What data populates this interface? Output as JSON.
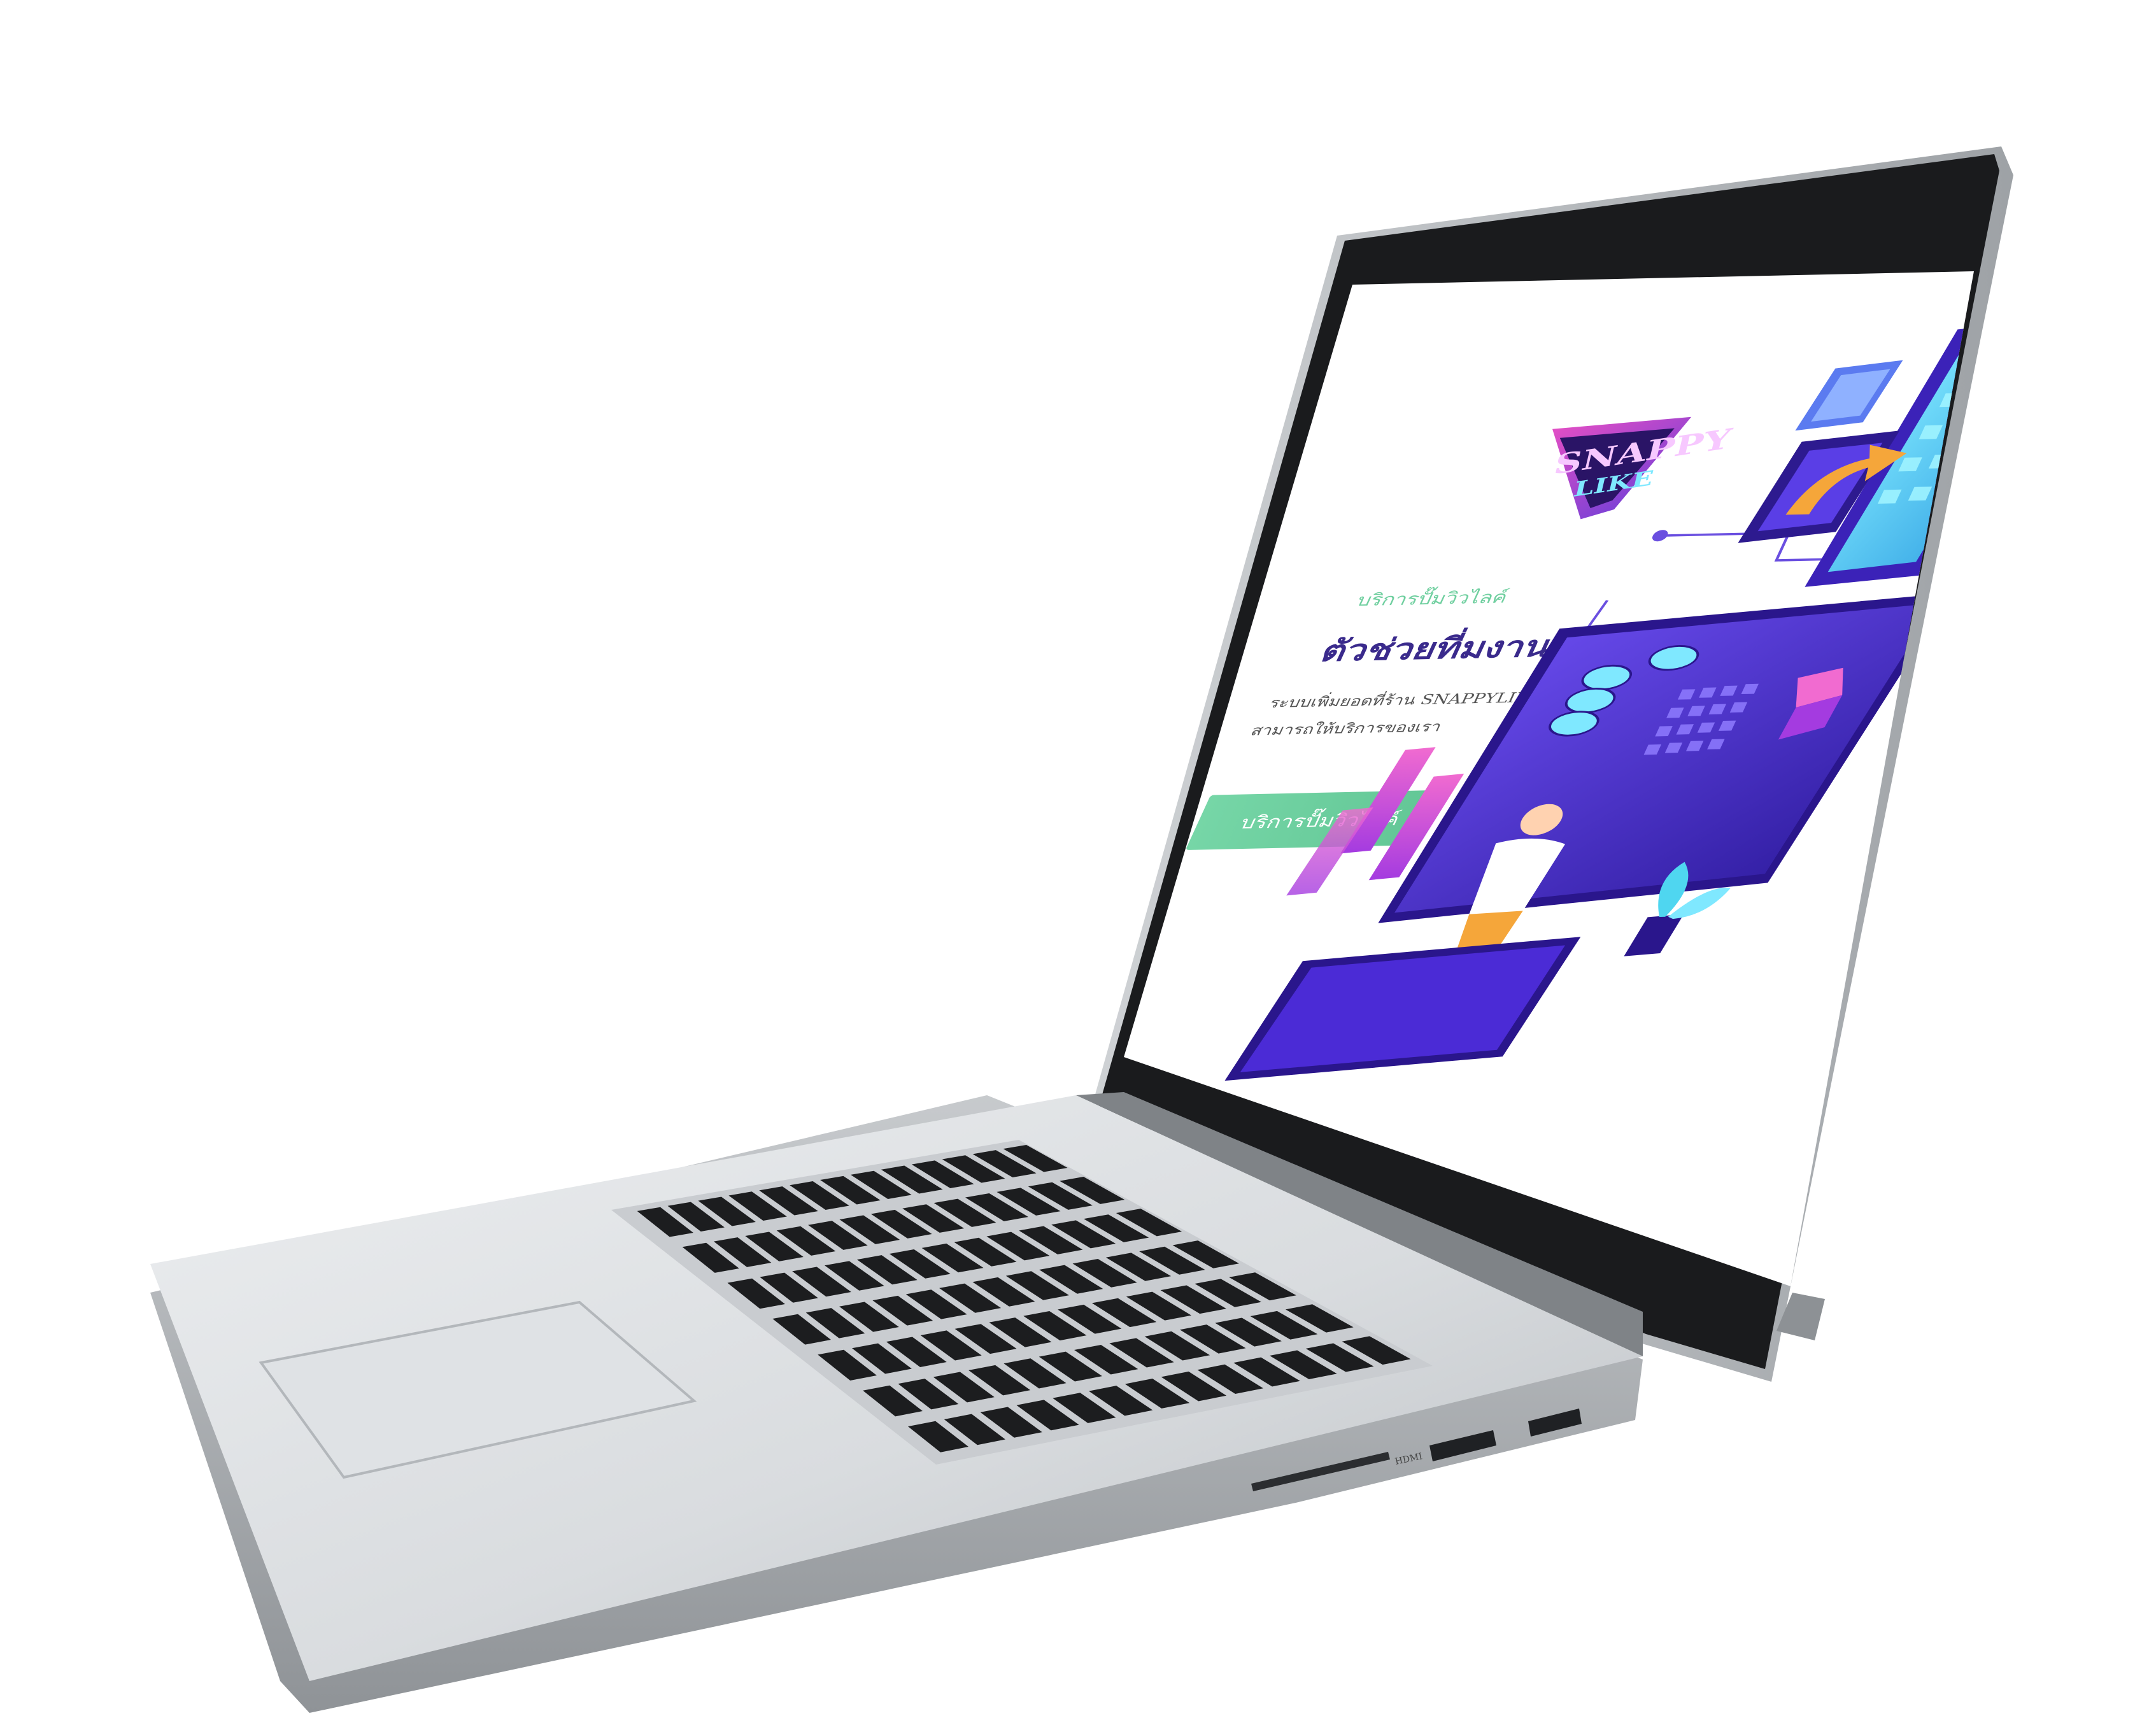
{
  "colors": {
    "accent_green": "#6fcf9f",
    "heading_purple": "#3a2a8c",
    "body_text": "#555555",
    "button_text": "#ffffff",
    "logo_pink": "#e84fc4",
    "logo_violet": "#6a3fd8",
    "illustration_primary": "#4b2bd6",
    "illustration_cyan": "#4fd6f0",
    "illustration_orange": "#f5a63a"
  },
  "website": {
    "logo": {
      "icon": "snappylike-logo",
      "line1": "SNAPPY",
      "line2": "LIKE"
    },
    "hero": {
      "kicker": "บริการปั๊มวิวไลค์",
      "heading": "ตัวช่วยที่มงานมืออาชีพ",
      "description_line1": "ระบบเพิ่มยอดที่ร้าน SNAPPYLIKE ที่ไปตามที่ร้านที่ร้านไลค์ได้เพิ่มเติม",
      "description_line2": "สามารถให้บริการของเรา",
      "cta_label": "บริการปั๊มวิวไลค์"
    },
    "illustration": {
      "icon": "isometric-tech-illustration"
    }
  },
  "device": {
    "ports": {
      "hdmi_label": "HDMI"
    }
  }
}
